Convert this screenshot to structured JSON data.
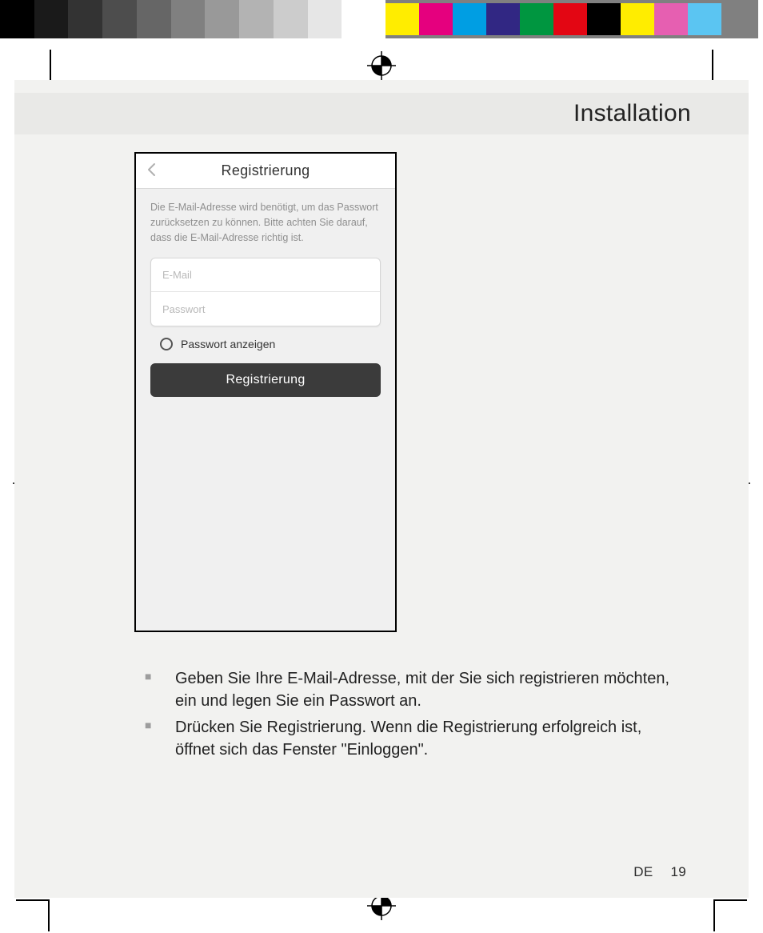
{
  "header": {
    "title": "Installation"
  },
  "phone": {
    "title": "Registrierung",
    "description": "Die E-Mail-Adresse wird benötigt, um das Passwort zurücksetzen zu können. Bitte achten Sie darauf, dass die E-Mail-Adresse richtig ist.",
    "email_placeholder": "E-Mail",
    "password_placeholder": "Passwort",
    "show_password_label": "Passwort anzeigen",
    "register_button_label": "Registrierung"
  },
  "instructions": {
    "bullet1": "Geben Sie Ihre E-Mail-Adresse, mit der Sie sich registrieren möchten, ein und legen Sie ein Passwort an.",
    "bullet2_prefix": "Drücken Sie ",
    "bullet2_bold": "Registrierung",
    "bullet2_suffix": ". Wenn die Registrierung erfolgreich ist, öffnet sich das Fenster \"Einloggen\"."
  },
  "footer": {
    "lang": "DE",
    "page": "19"
  },
  "colorbar_colors": [
    "#ffed00",
    "#e5007e",
    "#009ee3",
    "#312783",
    "#009640",
    "#e30613",
    "#000000",
    "#ffed00",
    "#e65fb1",
    "#5bc5f2",
    "#808080"
  ],
  "graybar_shades": [
    "#000",
    "#1a1a1a",
    "#333",
    "#4d4d4d",
    "#666",
    "#808080",
    "#999",
    "#b3b3b3",
    "#ccc",
    "#e6e6e6",
    "#fff"
  ]
}
